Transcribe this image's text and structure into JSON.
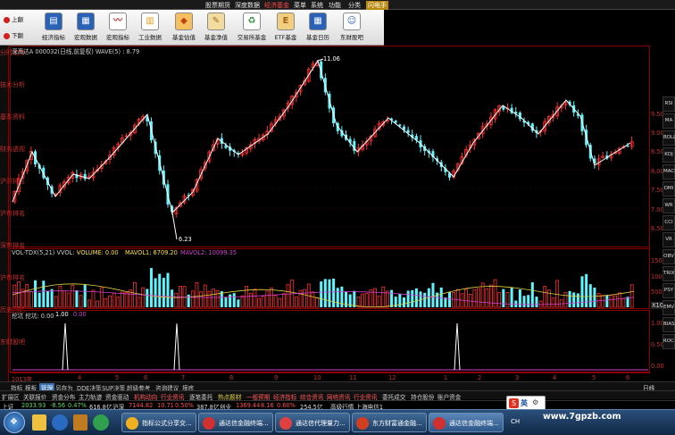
{
  "top_menu": {
    "items": [
      "股票期货",
      "深度数据",
      "经济基金",
      "菜单",
      "系统",
      "功能",
      "分类"
    ],
    "active": "经济基金",
    "badge": "闪电手"
  },
  "toolbar": {
    "side_buttons": [
      {
        "label": "上翻",
        "icon": "up-arrow-icon",
        "color": "#d02020"
      },
      {
        "label": "下翻",
        "icon": "down-arrow-icon",
        "color": "#d02020"
      }
    ],
    "buttons": [
      {
        "label": "经济指标",
        "icon": "economy-icon",
        "color": "#2a62b8"
      },
      {
        "label": "宏观数据",
        "icon": "macro-data-icon",
        "color": "#2a62b8"
      },
      {
        "label": "宏观指标",
        "icon": "macro-chart-icon",
        "color": "#c73030"
      },
      {
        "label": "工业数据",
        "icon": "industry-icon",
        "color": "#e0a020"
      },
      {
        "label": "基金估值",
        "icon": "fund-value-icon",
        "color": "#d0501f"
      },
      {
        "label": "基金净值",
        "icon": "fund-nav-icon",
        "color": "#c8a050"
      },
      {
        "label": "交易所基金",
        "icon": "exchange-fund-icon",
        "color": "#2a8a3a"
      },
      {
        "label": "ETF基金",
        "icon": "etf-icon",
        "color": "#c99020"
      },
      {
        "label": "基金日历",
        "icon": "calendar-icon",
        "color": "#2a62b8"
      },
      {
        "label": "东财股吧",
        "icon": "forum-icon",
        "color": "#2a62b8"
      }
    ]
  },
  "left_tabs": [
    "分时走势",
    "技术分析",
    "基本资料",
    "财务透视",
    "沪深排名",
    "沪市排名",
    "深市排名",
    "沪市排名",
    "历史回忆",
    "东财股吧"
  ],
  "price_panel": {
    "header": "深高达A  000032(日线,前复权)  WAVE(5) : 8.79",
    "high_label": "11.06",
    "low_label": "6.23",
    "y_ticks": [
      "9.50",
      "9.00",
      "8.50",
      "8.00",
      "7.50",
      "7.00",
      "6.50"
    ]
  },
  "volume_panel": {
    "header_name": "VOL-TDX(5,21)  VVOL: -",
    "volume": "VOLUME: 0.00",
    "mavol1": "MAVOL1: 6709.20",
    "mavol2": "MAVOL2: 10099.35",
    "y_ticks": [
      "15000",
      "10000",
      "5000"
    ],
    "unit": "X10"
  },
  "indicator_panel": {
    "header_name": "挖坑 挖坑: 0.00",
    "v1": "1.00",
    "v2": "0.00",
    "y_ticks": [
      "1.00",
      "0.50",
      "0.00"
    ]
  },
  "x_axis": {
    "labels": [
      "2013年",
      "4",
      "5",
      "6",
      "7",
      "8",
      "9",
      "10",
      "11",
      "12",
      "1",
      "2",
      "3",
      "4",
      "5",
      "6"
    ]
  },
  "tab_row1": [
    "指标",
    "模板",
    "管理",
    "另存为",
    "DDE决策",
    "SUP决策",
    "超级参考",
    "咨询建议",
    "摸底"
  ],
  "tab_row1_selected": "管理",
  "tab_row2": [
    "扩展区",
    "关联报价",
    "资金分布",
    "主力轨迹",
    "资金驱动",
    "机构动向",
    "行业资讯",
    "逐笔委托",
    "热点题材",
    "一般预期",
    "经济指标",
    "综合资讯",
    "网络资讯",
    "行业资讯",
    "委托成交",
    "持仓股份",
    "账户资金"
  ],
  "status_bar": {
    "sh_label": "上证",
    "sh_value": "2033.93",
    "sh_change": "-8.56",
    "sh_pct": "0.47%",
    "sh_amount": "616.8亿",
    "sz_label": "沪深",
    "sz_value": "7144.82",
    "sz_change": "10.71",
    "sz_pct": "0.50%",
    "sz_amount": "387.8亿",
    "cy_label": "创业",
    "cy_value": "1369.44",
    "cy_change": "8.16",
    "cy_pct": "0.60%",
    "cy_amount": "254.5亿",
    "feed": "高级行情 上海电信1"
  },
  "taskbar": {
    "tasks": [
      {
        "label": "指标公式分享交...",
        "icon": "browser-icon",
        "color": "#f0b020"
      },
      {
        "label": "通达信金融终端...",
        "icon": "tdx-icon",
        "color": "#d03030"
      },
      {
        "label": "通达信代理量力...",
        "icon": "tdx-proxy-icon",
        "color": "#e04040"
      },
      {
        "label": "东方财富通金融...",
        "icon": "eastmoney-icon",
        "color": "#d04020"
      },
      {
        "label": "通达信金融终端...",
        "icon": "tdx-icon",
        "color": "#d03030"
      }
    ],
    "ime_label": "英",
    "tray_time": "CH"
  },
  "watermark": "www.7gpzb.com",
  "right_icons": [
    "RSI",
    "MA",
    "BOLL",
    "KDJ",
    "MACD",
    "DMI",
    "WR",
    "CCI",
    "VR",
    "OBV",
    "TRIX",
    "PSY",
    "EMV",
    "BIAS",
    "ROC"
  ],
  "colors": {
    "up": "#ff3030",
    "down": "#5ff5ff",
    "wave": "#ffffff",
    "ma1": "#ffffff",
    "ma2": "#e0d040",
    "ma3": "#d040d0",
    "grid": "#8a0000",
    "axis": "#c9302c"
  }
}
